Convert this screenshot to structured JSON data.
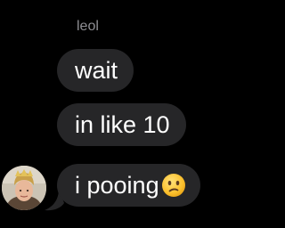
{
  "conversation": {
    "sender_name": "leol",
    "messages": [
      {
        "text": "wait"
      },
      {
        "text": "in like 10"
      },
      {
        "text": "i pooing",
        "emoji": "confused-face-emoji"
      }
    ]
  },
  "colors": {
    "background": "#000000",
    "bubble": "#262628",
    "sender_name": "#8e8e93",
    "text": "#ffffff"
  }
}
